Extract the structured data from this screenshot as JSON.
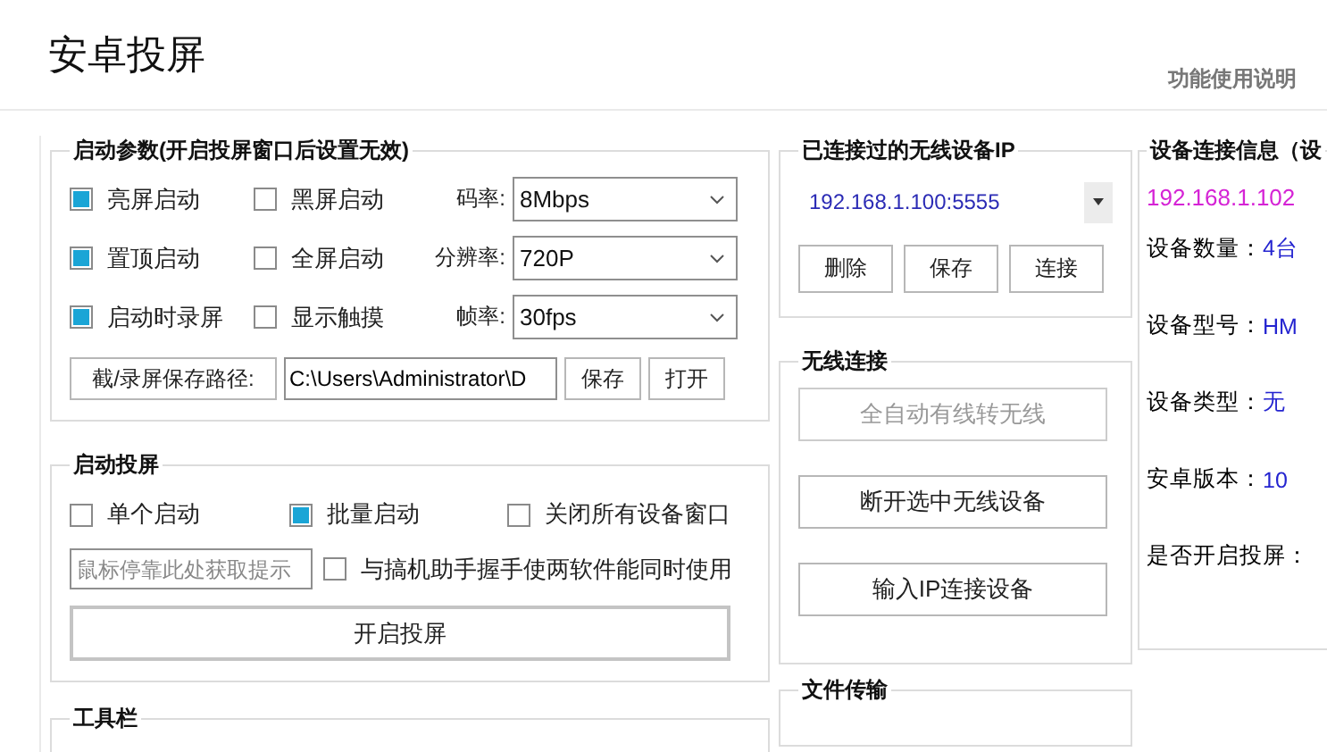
{
  "window": {
    "title": "安卓投屏",
    "help_link": "功能使用说明"
  },
  "launch_params": {
    "title": "启动参数(开启投屏窗口后设置无效)",
    "rows": [
      {
        "options": [
          {
            "label": "亮屏启动",
            "checked": true
          },
          {
            "label": "黑屏启动",
            "checked": false
          }
        ],
        "setting": {
          "label": "码率:",
          "value": "8Mbps"
        }
      },
      {
        "options": [
          {
            "label": "置顶启动",
            "checked": true
          },
          {
            "label": "全屏启动",
            "checked": false
          }
        ],
        "setting": {
          "label": "分辨率:",
          "value": "720P"
        }
      },
      {
        "options": [
          {
            "label": "启动时录屏",
            "checked": true
          },
          {
            "label": "显示触摸",
            "checked": false
          }
        ],
        "setting": {
          "label": "帧率:",
          "value": "30fps"
        }
      }
    ],
    "save_path": {
      "button": "截/录屏保存路径:",
      "value": "C:\\Users\\Administrator\\D",
      "buttons": [
        "保存",
        "打开"
      ]
    }
  },
  "launch": {
    "title": "启动投屏",
    "options": [
      {
        "label": "单个启动",
        "checked": false
      },
      {
        "label": "批量启动",
        "checked": true
      },
      {
        "label": "关闭所有设备窗口",
        "checked": false
      }
    ],
    "hint": {
      "placeholder": "鼠标停靠此处获取提示"
    },
    "coexist": {
      "label": "与搞机助手握手使两软件能同时使用",
      "checked": false
    },
    "start_button": "开启投屏"
  },
  "toolbar": {
    "title": "工具栏"
  },
  "wireless_history": {
    "title": "已连接过的无线设备IP",
    "selected_ip": "192.168.1.100:5555",
    "buttons": [
      "删除",
      "保存",
      "连接"
    ]
  },
  "wireless": {
    "title": "无线连接",
    "buttons": [
      {
        "label": "全自动有线转无线",
        "disabled": true
      },
      {
        "label": "断开选中无线设备",
        "disabled": false
      },
      {
        "label": "输入IP连接设备",
        "disabled": false
      }
    ]
  },
  "file_transfer": {
    "title": "文件传输"
  },
  "device_info": {
    "title": "设备连接信息（设",
    "ip": "192.168.1.102",
    "fields": [
      {
        "label": "设备数量：",
        "value": "4台"
      },
      {
        "label": "设备型号：",
        "value": "HM"
      },
      {
        "label": "设备类型：",
        "value": "无"
      },
      {
        "label": "安卓版本：",
        "value": "10"
      },
      {
        "label": "是否开启投屏："
      }
    ]
  }
}
